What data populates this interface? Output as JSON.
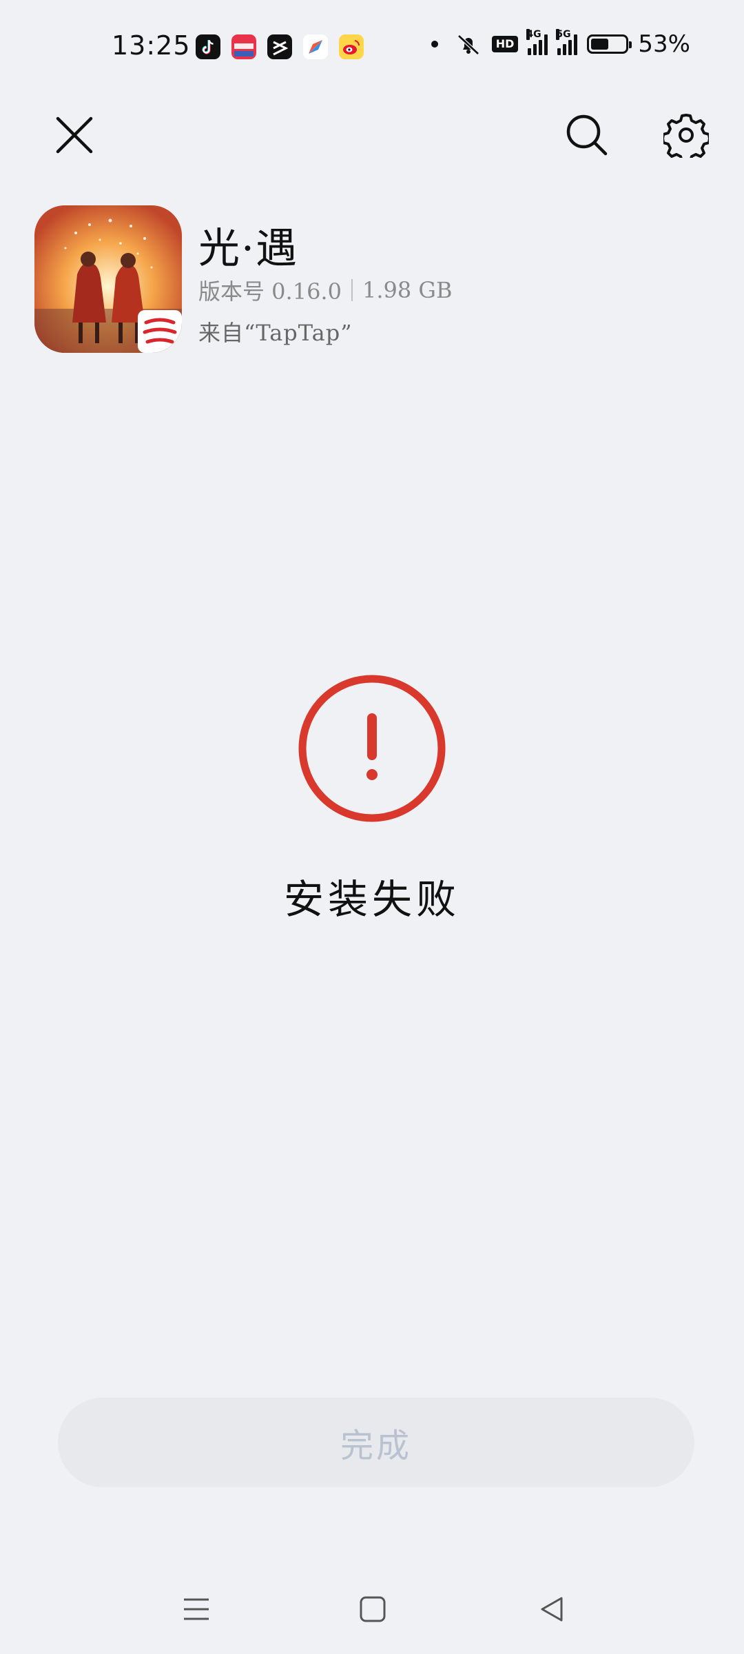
{
  "status_bar": {
    "time": "13:25",
    "battery_percent": "53%",
    "battery_level": 0.53,
    "hd_label": "HD",
    "network_4g": "4G",
    "network_5g": "5G",
    "notification_icons": [
      "douyin-icon",
      "xiaohongshu-icon",
      "capcut-icon",
      "browser-icon",
      "weibo-icon"
    ]
  },
  "topbar": {
    "close_icon": "close-icon",
    "search_icon": "search-icon",
    "settings_icon": "gear-icon"
  },
  "app": {
    "name": "光·遇",
    "version_label": "版本号 0.16.0",
    "size": "1.98 GB",
    "source": "来自“TapTap”"
  },
  "result": {
    "icon": "exclamation-circle-icon",
    "message": "安装失败",
    "accent_color": "#d9382c"
  },
  "actions": {
    "done_label": "完成"
  },
  "navbar": {
    "menu_icon": "menu-icon",
    "home_icon": "home-icon",
    "back_icon": "back-icon"
  }
}
